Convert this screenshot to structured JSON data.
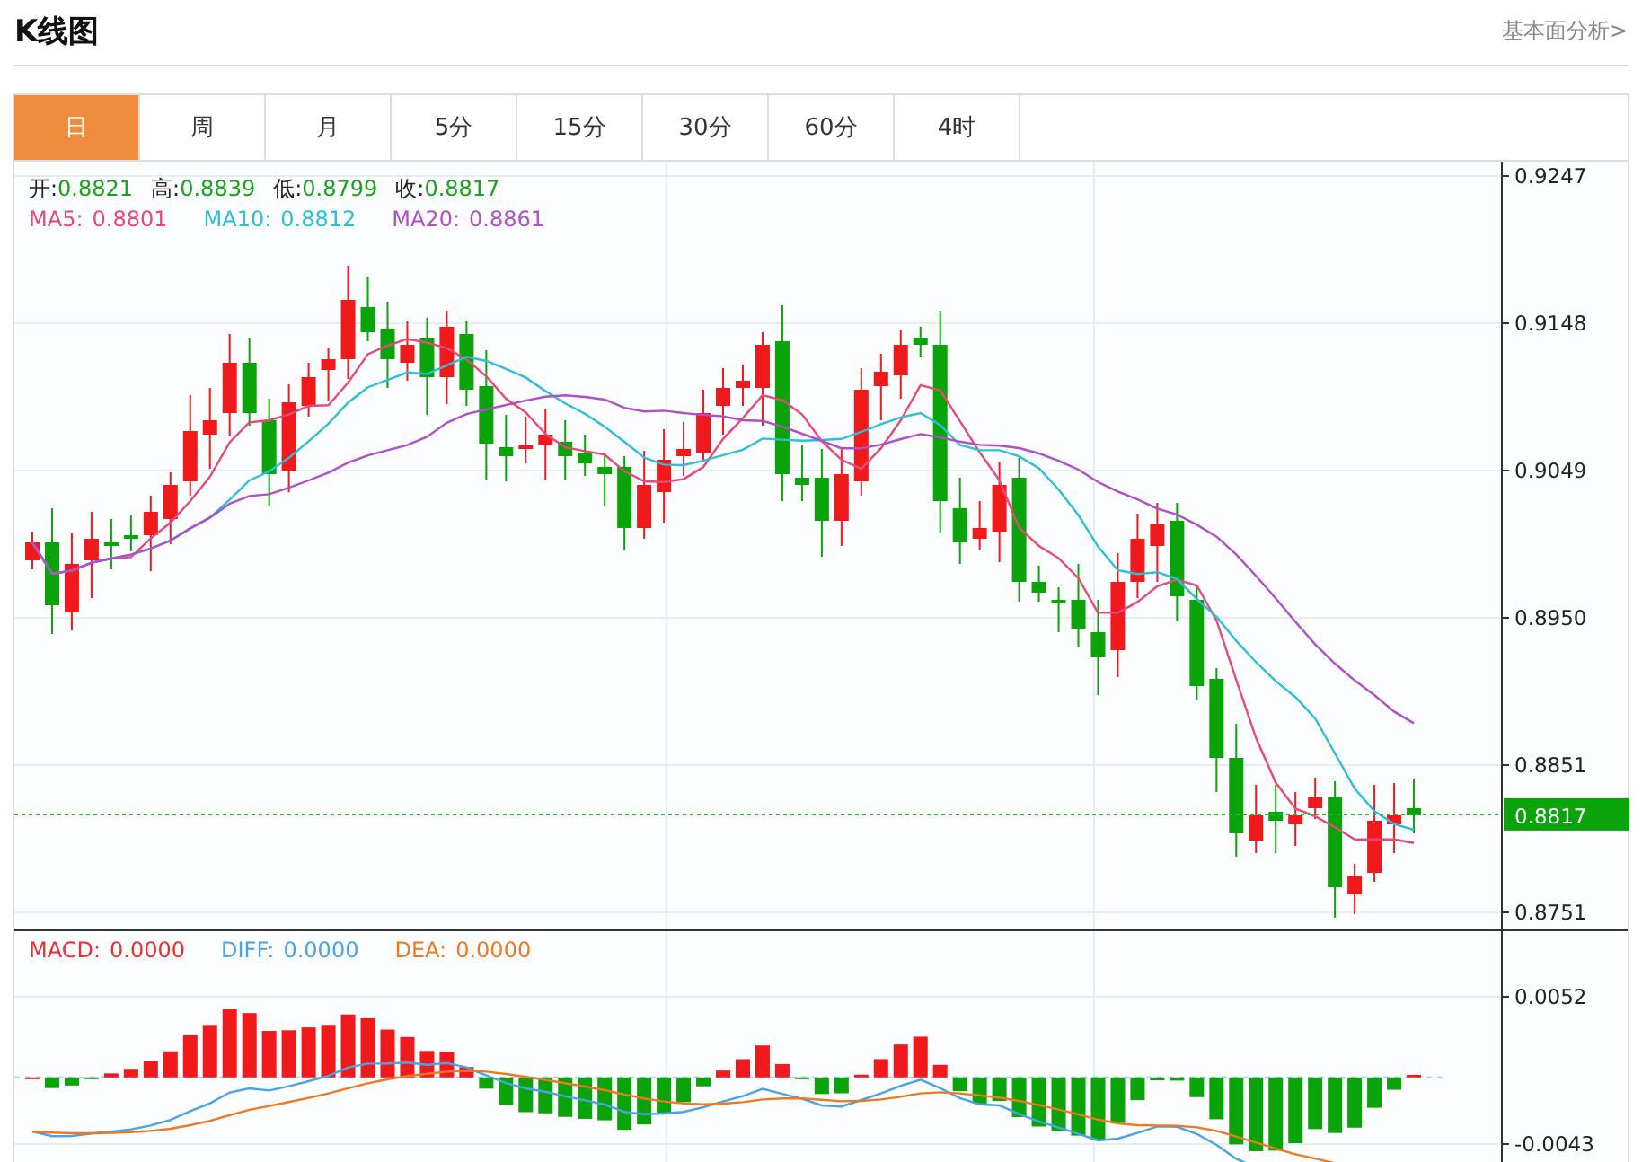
{
  "header": {
    "title": "K线图",
    "link": "基本面分析>"
  },
  "tabs": [
    {
      "label": "日",
      "selected": true
    },
    {
      "label": "周",
      "selected": false
    },
    {
      "label": "月",
      "selected": false
    },
    {
      "label": "5分",
      "selected": false
    },
    {
      "label": "15分",
      "selected": false
    },
    {
      "label": "30分",
      "selected": false
    },
    {
      "label": "60分",
      "selected": false
    },
    {
      "label": "4时",
      "selected": false
    }
  ],
  "quote": [
    {
      "label": "开:",
      "value": "0.8821"
    },
    {
      "label": "高:",
      "value": "0.8839"
    },
    {
      "label": "低:",
      "value": "0.8799"
    },
    {
      "label": "收:",
      "value": "0.8817"
    }
  ],
  "moving_averages": [
    {
      "label": "MA5:",
      "value": "0.8801",
      "color": "#e8487a"
    },
    {
      "label": "MA10:",
      "value": "0.8812",
      "color": "#2bbfd9"
    },
    {
      "label": "MA20:",
      "value": "0.8861",
      "color": "#b04fc8"
    }
  ],
  "price_axis": {
    "ticks": [
      "0.9247",
      "0.9148",
      "0.9049",
      "0.8950",
      "0.8851",
      "0.8751"
    ],
    "current_price": "0.8817"
  },
  "macd_legend": [
    {
      "label": "MACD:",
      "value": "0.0000",
      "color": "#e83030"
    },
    {
      "label": "DIFF:",
      "value": "0.0000",
      "color": "#4aa3e8"
    },
    {
      "label": "DEA:",
      "value": "0.0000",
      "color": "#f07820"
    }
  ],
  "macd_axis": {
    "ticks": [
      "0.0052",
      "-0.0043"
    ]
  }
}
